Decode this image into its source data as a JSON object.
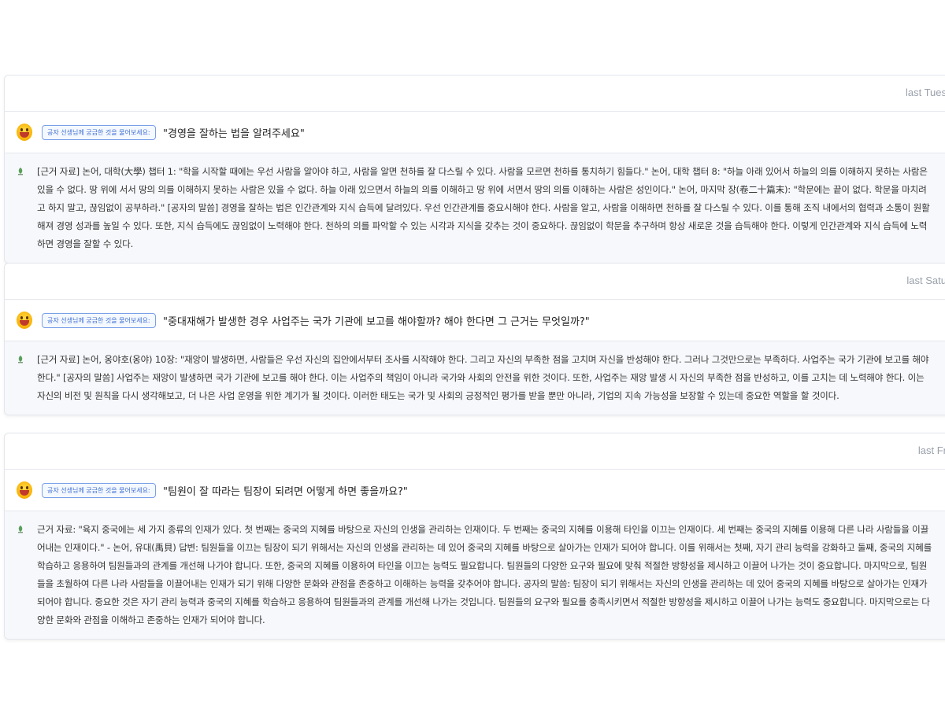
{
  "prompt_label": "공자 선생님께 궁금한 것을 물어보세요:",
  "conversations": [
    {
      "timestamp": "last Tues",
      "question": "\"경영을 잘하는 법을 알려주세요\"",
      "answer": "[근거 자료] 논어, 대학(大學) 챕터 1: \"학을 시작할 때에는 우선 사람을 알아야 하고, 사람을 알면 천하를 잘 다스릴 수 있다. 사람을 모르면 천하를 통치하기 힘들다.\" 논어, 대학 챕터 8: \"하늘 아래 있어서 하늘의 의를 이해하지 못하는 사람은 있을 수 없다. 땅 위에 서서 땅의 의를 이해하지 못하는 사람은 있을 수 없다. 하늘 아래 있으면서 하늘의 의를 이해하고 땅 위에 서면서 땅의 의를 이해하는 사람은 성인이다.\" 논어, 마지막 장(卷二十篇末): \"학문에는 끝이 없다. 학문을 마치려고 하지 말고, 끊임없이 공부하라.\" [공자의 말씀] 경영을 잘하는 법은 인간관계와 지식 습득에 달려있다. 우선 인간관계를 중요시해야 한다. 사람을 알고, 사람을 이해하면 천하를 잘 다스릴 수 있다. 이를 통해 조직 내에서의 협력과 소통이 원활해져 경영 성과를 높일 수 있다. 또한, 지식 습득에도 끊임없이 노력해야 한다. 천하의 의를 파악할 수 있는 시각과 지식을 갖추는 것이 중요하다. 끊임없이 학문을 추구하며 항상 새로운 것을 습득해야 한다. 이렇게 인간관계와 지식 습득에 노력하면 경영을 잘할 수 있다."
    },
    {
      "timestamp": "last Satu",
      "question": "\"중대재해가 발생한 경우 사업주는 국가 기관에 보고를 해야할까? 해야 한다면 그 근거는 무엇일까?\"",
      "answer": "[근거 자료] 논어, 옹야호(옹야) 10장: \"재앙이 발생하면, 사람들은 우선 자신의 집안에서부터 조사를 시작해야 한다. 그리고 자신의 부족한 점을 고치며 자신을 반성해야 한다. 그러나 그것만으로는 부족하다. 사업주는 국가 기관에 보고를 해야 한다.\" [공자의 말씀] 사업주는 재앙이 발생하면 국가 기관에 보고를 해야 한다. 이는 사업주의 책임이 아니라 국가와 사회의 안전을 위한 것이다. 또한, 사업주는 재앙 발생 시 자신의 부족한 점을 반성하고, 이를 고치는 데 노력해야 한다. 이는 자신의 비전 및 원칙을 다시 생각해보고, 더 나은 사업 운영을 위한 계기가 될 것이다. 이러한 태도는 국가 및 사회의 긍정적인 평가를 받을 뿐만 아니라, 기업의 지속 가능성을 보장할 수 있는데 중요한 역할을 할 것이다."
    },
    {
      "timestamp": "last Fr",
      "question": "\"팀원이 잘 따라는 팀장이 되려면 어떻게 하면 좋을까요?\"",
      "answer": "근거 자료: \"육지 중국에는 세 가지 종류의 인재가 있다. 첫 번째는 중국의 지혜를 바탕으로 자신의 인생을 관리하는 인재이다. 두 번째는 중국의 지혜를 이용해 타인을 이끄는 인재이다. 세 번째는 중국의 지혜를 이용해 다른 나라 사람들을 이끌어내는 인재이다.\" - 논어, 유대(禹貝) 답변: 팀원들을 이끄는 팀장이 되기 위해서는 자신의 인생을 관리하는 데 있어 중국의 지혜를 바탕으로 살아가는 인재가 되어야 합니다. 이를 위해서는 첫째, 자기 관리 능력을 강화하고 둘째, 중국의 지혜를 학습하고 응용하여 팀원들과의 관계를 개선해 나가야 합니다. 또한, 중국의 지혜를 이용하여 타인을 이끄는 능력도 필요합니다. 팀원들의 다양한 요구와 필요에 맞춰 적절한 방향성을 제시하고 이끌어 나가는 것이 중요합니다. 마지막으로, 팀원들을 초월하여 다른 나라 사람들을 이끌어내는 인재가 되기 위해 다양한 문화와 관점을 존중하고 이해하는 능력을 갖추어야 합니다. 공자의 말씀: 팀장이 되기 위해서는 자신의 인생을 관리하는 데 있어 중국의 지혜를 바탕으로 살아가는 인재가 되어야 합니다. 중요한 것은 자기 관리 능력과 중국의 지혜를 학습하고 응용하여 팀원들과의 관계를 개선해 나가는 것입니다. 팀원들의 요구와 필요를 충족시키면서 적절한 방향성을 제시하고 이끌어 나가는 능력도 중요합니다. 마지막으로는 다양한 문화와 관점을 이해하고 존중하는 인재가 되어야 합니다."
    }
  ]
}
